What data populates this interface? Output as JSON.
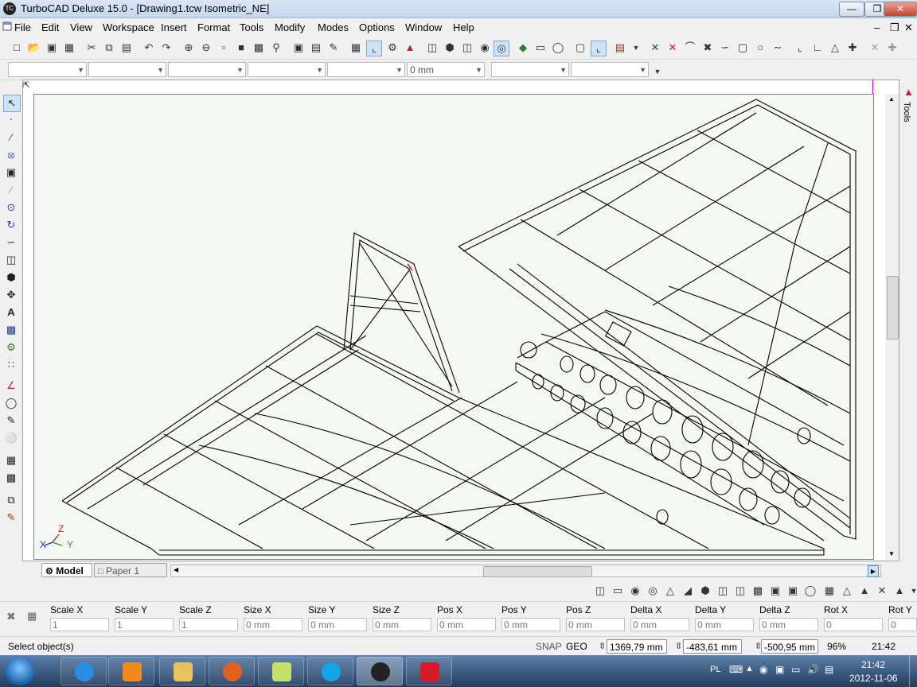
{
  "window": {
    "app_icon": "TC",
    "title": "TurboCAD Deluxe 15.0 - [Drawing1.tcw Isometric_NE]",
    "buttons": {
      "minimize": "—",
      "restore": "❒",
      "close": "✕"
    }
  },
  "menu": {
    "items": [
      "File",
      "Edit",
      "View",
      "Workspace",
      "Insert",
      "Format",
      "Tools",
      "Modify",
      "Modes",
      "Options",
      "Window",
      "Help"
    ],
    "mdi_buttons": [
      "–",
      "❒",
      "✕"
    ]
  },
  "property_toolbar": {
    "combos": [
      "",
      "",
      "",
      "",
      "",
      "0 mm",
      "",
      ""
    ]
  },
  "tabs": {
    "model": "Model",
    "paper": "Paper 1"
  },
  "right_panel": {
    "label": "Tools"
  },
  "axes": {
    "z": "Z",
    "x": "X",
    "y": "Y"
  },
  "inspector": {
    "fields": [
      {
        "label": "Scale X",
        "value": "1"
      },
      {
        "label": "Scale Y",
        "value": "1"
      },
      {
        "label": "Scale Z",
        "value": "1"
      },
      {
        "label": "Size X",
        "value": "0 mm"
      },
      {
        "label": "Size Y",
        "value": "0 mm"
      },
      {
        "label": "Size Z",
        "value": "0 mm"
      },
      {
        "label": "Pos X",
        "value": "0 mm"
      },
      {
        "label": "Pos Y",
        "value": "0 mm"
      },
      {
        "label": "Pos Z",
        "value": "0 mm"
      },
      {
        "label": "Delta X",
        "value": "0 mm"
      },
      {
        "label": "Delta Y",
        "value": "0 mm"
      },
      {
        "label": "Delta Z",
        "value": "0 mm"
      },
      {
        "label": "Rot X",
        "value": "0"
      },
      {
        "label": "Rot Y",
        "value": "0"
      }
    ]
  },
  "status": {
    "prompt": "Select object(s)",
    "snap": "SNAP",
    "geo": "GEO",
    "coord_x": "1369,79 mm",
    "coord_y": "-483,61 mm",
    "coord_z": "-500,95 mm",
    "zoom": "96%",
    "time": "21:42"
  },
  "taskbar": {
    "apps": [
      {
        "name": "internet-explorer",
        "color": "#2a8ee0"
      },
      {
        "name": "media-player",
        "color": "#f08a1e"
      },
      {
        "name": "file-explorer",
        "color": "#e8c35a"
      },
      {
        "name": "firefox",
        "color": "#e2621b"
      },
      {
        "name": "sticky-notes",
        "color": "#c7e06a"
      },
      {
        "name": "skype",
        "color": "#11a6e8"
      },
      {
        "name": "turbocad",
        "color": "#222222"
      },
      {
        "name": "paint-app",
        "color": "#d81b2a"
      }
    ],
    "tray": {
      "lang": "PL",
      "time": "21:42",
      "date": "2012-11-06"
    }
  }
}
